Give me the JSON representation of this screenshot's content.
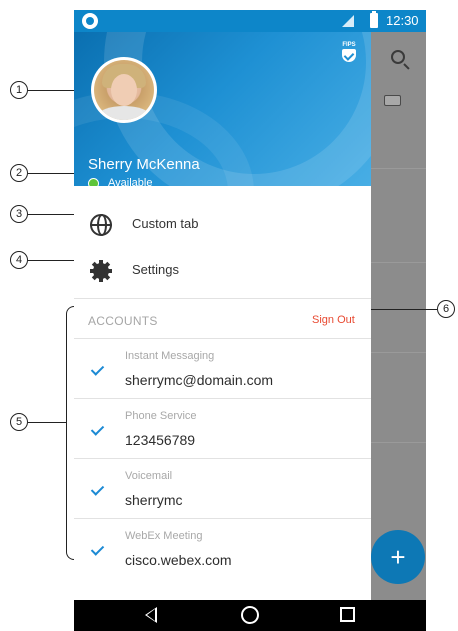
{
  "status_bar": {
    "time": "12:30"
  },
  "drawer": {
    "badge_text": "FIPS",
    "profile": {
      "name": "Sherry McKenna",
      "presence": "Available",
      "presence_color": "#5ec43a"
    },
    "menu": [
      {
        "label": "Custom tab",
        "icon": "globe-icon"
      },
      {
        "label": "Settings",
        "icon": "gear-icon"
      }
    ],
    "accounts": {
      "header": "ACCOUNTS",
      "sign_out": "Sign Out",
      "items": [
        {
          "type": "Instant Messaging",
          "value": "sherrymc@domain.com"
        },
        {
          "type": "Phone Service",
          "value": "123456789"
        },
        {
          "type": "Voicemail",
          "value": "sherrymc"
        },
        {
          "type": "WebEx Meeting",
          "value": "cisco.webex.com"
        }
      ]
    }
  },
  "background_app": {
    "fab_label": "+"
  },
  "callouts": [
    "1",
    "2",
    "3",
    "4",
    "5",
    "6"
  ],
  "colors": {
    "accent": "#1e90d3",
    "sign_out": "#e84a32",
    "check": "#1c8ad4"
  }
}
